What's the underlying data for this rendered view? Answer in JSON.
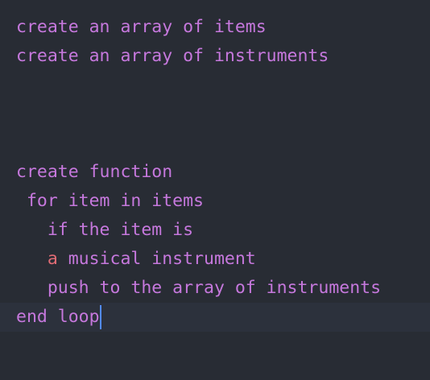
{
  "editor": {
    "colors": {
      "background": "#282c34",
      "keyword": "#c678dd",
      "variable": "#e06c75",
      "cursor": "#528bff",
      "current_line": "#2c313c"
    },
    "lines": [
      "create an array of items",
      "create an array of instruments",
      "",
      "",
      "",
      "create function",
      " for item in items",
      "   if the item is",
      "   ",
      "   push to the array of instruments",
      "end loop"
    ],
    "line8_token": "a",
    "line8_rest": " musical instrument"
  }
}
